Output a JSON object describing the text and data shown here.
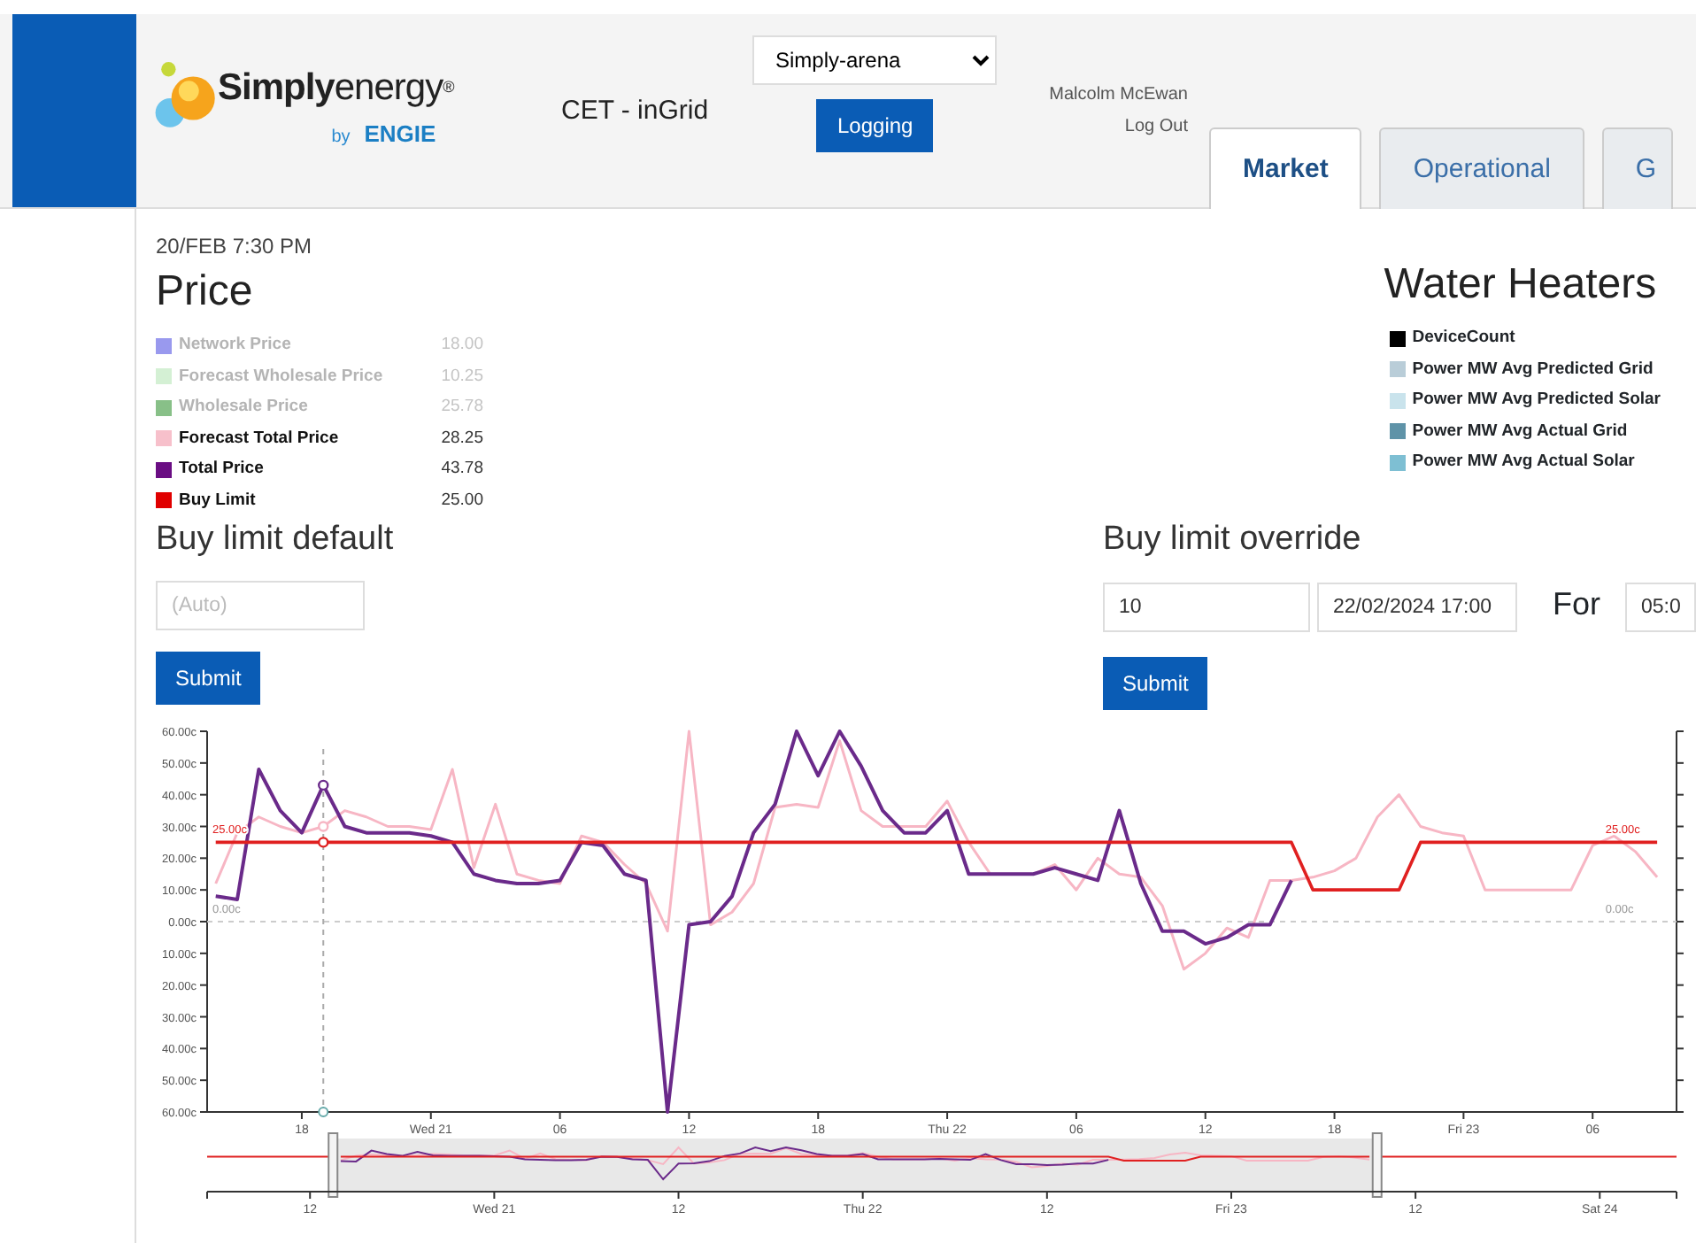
{
  "brand": {
    "name": "**Simply**energy",
    "registered": "®",
    "byline": "by",
    "partner": "ENGIE"
  },
  "app_title": "CET - inGrid",
  "site_select": {
    "value": "Simply-arena"
  },
  "logging_button": "Logging",
  "user": {
    "name": "Malcolm McEwan",
    "logout": "Log Out"
  },
  "tabs": [
    {
      "label": "Market",
      "selected": true
    },
    {
      "label": "Operational",
      "selected": false
    },
    {
      "label": "G",
      "selected": false
    }
  ],
  "timestamp": "20/FEB 7:30 PM",
  "price": {
    "title": "Price",
    "legend": [
      {
        "name": "Network Price",
        "value": "18.00",
        "color": "#9999ee",
        "active": false
      },
      {
        "name": "Forecast Wholesale Price",
        "value": "10.25",
        "color": "#d4f0d4",
        "active": false
      },
      {
        "name": "Wholesale Price",
        "value": "25.78",
        "color": "#88c088",
        "active": false
      },
      {
        "name": "Forecast Total Price",
        "value": "28.25",
        "color": "#f7c0cb",
        "active": true
      },
      {
        "name": "Total Price",
        "value": "43.78",
        "color": "#6a0d83",
        "active": true
      },
      {
        "name": "Buy Limit",
        "value": "25.00",
        "color": "#e00000",
        "active": true
      }
    ]
  },
  "water_heaters": {
    "title": "Water Heaters",
    "legend": [
      {
        "name": "DeviceCount",
        "color": "#000000"
      },
      {
        "name": "Power MW Avg Predicted Grid",
        "color": "#b9cdd8"
      },
      {
        "name": "Power MW Avg Predicted Solar",
        "color": "#c9e3ec"
      },
      {
        "name": "Power MW Avg Actual Grid",
        "color": "#5f93a8"
      },
      {
        "name": "Power MW Avg Actual Solar",
        "color": "#7ebfd3"
      }
    ]
  },
  "buy_limit_default": {
    "title": "Buy limit default",
    "placeholder": "(Auto)",
    "submit": "Submit"
  },
  "buy_limit_override": {
    "title": "Buy limit override",
    "value": "10",
    "start": "22/02/2024 17:00",
    "for_label": "For",
    "duration": "05:0",
    "submit": "Submit"
  },
  "chart_data": {
    "type": "line",
    "ylim": [
      -60,
      60
    ],
    "categories": [
      null,
      null,
      null,
      null,
      "18",
      null,
      null,
      null,
      null,
      null,
      "Wed 21",
      null,
      null,
      null,
      null,
      null,
      "06",
      null,
      null,
      null,
      null,
      null,
      "12",
      null,
      null,
      null,
      null,
      null,
      "18",
      null,
      null,
      null,
      null,
      null,
      "Thu 22",
      null,
      null,
      null,
      null,
      null,
      "06",
      null,
      null,
      null,
      null,
      null,
      "12",
      null,
      null,
      null,
      null,
      null,
      "18",
      null,
      null,
      null,
      null,
      null,
      "Fri 23",
      null,
      null,
      null,
      null,
      null,
      "06",
      null,
      null,
      null
    ],
    "series": [
      {
        "color": "#f7b6c4",
        "values": [
          12,
          28,
          33,
          30,
          28,
          30,
          35,
          33,
          30,
          30,
          29,
          48,
          17,
          37,
          15,
          13,
          12,
          27,
          25,
          18,
          12,
          -3,
          60,
          -1,
          3,
          12,
          36,
          37,
          36,
          57,
          35,
          30,
          30,
          30,
          38,
          25,
          15,
          15,
          15,
          18,
          10,
          20,
          15,
          14,
          5,
          -15,
          -10,
          -2,
          -5,
          13,
          13,
          14,
          16,
          20,
          33,
          40,
          30,
          28,
          27,
          10,
          10,
          10,
          10,
          10,
          24,
          27,
          22,
          14
        ]
      },
      {
        "color": "#6a2a8a",
        "values": [
          8,
          7,
          48,
          35,
          28,
          43,
          30,
          28,
          28,
          28,
          27,
          25,
          15,
          13,
          12,
          12,
          13,
          25,
          24,
          15,
          13,
          -60,
          -1,
          0,
          8,
          28,
          37,
          60,
          46,
          60,
          49,
          35,
          28,
          28,
          35,
          15,
          15,
          15,
          15,
          17,
          15,
          13,
          35,
          12,
          -3,
          -3,
          -7,
          -5,
          -1,
          -1,
          13,
          null,
          null,
          null,
          null,
          null,
          null,
          null,
          null,
          null,
          null,
          null,
          null,
          null,
          null,
          null,
          null,
          null
        ]
      },
      {
        "color": "#e02020",
        "values": [
          25,
          25,
          25,
          25,
          25,
          25,
          25,
          25,
          25,
          25,
          25,
          25,
          25,
          25,
          25,
          25,
          25,
          25,
          25,
          25,
          25,
          25,
          25,
          25,
          25,
          25,
          25,
          25,
          25,
          25,
          25,
          25,
          25,
          25,
          25,
          25,
          25,
          25,
          25,
          25,
          25,
          25,
          25,
          25,
          25,
          25,
          25,
          25,
          25,
          25,
          25,
          10,
          10,
          10,
          10,
          10,
          25,
          25,
          25,
          25,
          25,
          25,
          25,
          25,
          25,
          25,
          25,
          25
        ]
      }
    ],
    "yticks": [
      {
        "value": 60,
        "label": "60.00c"
      },
      {
        "value": 50,
        "label": "50.00c"
      },
      {
        "value": 40,
        "label": "40.00c"
      },
      {
        "value": 30,
        "label": "30.00c"
      },
      {
        "value": 20,
        "label": "20.00c"
      },
      {
        "value": 10,
        "label": "10.00c"
      },
      {
        "value": 0,
        "label": "0.00c"
      },
      {
        "value": -10,
        "label": "10.00c"
      },
      {
        "value": -20,
        "label": "20.00c"
      },
      {
        "value": -30,
        "label": "30.00c"
      },
      {
        "value": -40,
        "label": "40.00c"
      },
      {
        "value": -50,
        "label": "50.00c"
      },
      {
        "value": -60,
        "label": "60.00c"
      }
    ],
    "ref_lines": [
      {
        "axis": "y",
        "value": 0,
        "label": "0.00c"
      }
    ],
    "annotations": [
      {
        "text": "25.00c",
        "y": 25
      },
      {
        "text": "25.00c",
        "y": 25
      },
      {
        "text": "0.00c"
      }
    ]
  },
  "navigator": {
    "ticks": [
      "12",
      "Wed 21",
      "12",
      "Thu 22",
      "12",
      "Fri 23",
      "12",
      "Sat 24"
    ]
  }
}
